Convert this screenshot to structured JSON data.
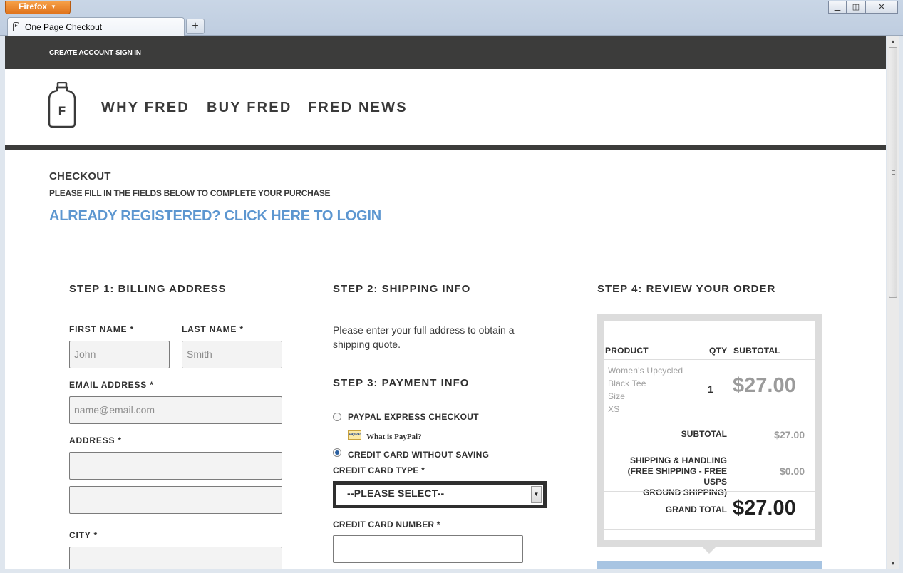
{
  "browser": {
    "menu_label": "Firefox",
    "tab_title": "One Page Checkout",
    "new_tab": "+",
    "controls": {
      "minimize": "▁",
      "restore": "◫",
      "close": "✕"
    }
  },
  "topbar": {
    "create_account": "CREATE ACCOUNT",
    "sign_in": "SIGN IN"
  },
  "logo": {
    "letter": "F"
  },
  "nav": [
    "WHY FRED",
    "BUY FRED",
    "FRED NEWS"
  ],
  "checkout": {
    "title": "CHECKOUT",
    "subtitle": "PLEASE FILL IN THE FIELDS BELOW TO COMPLETE YOUR PURCHASE",
    "login_link": "ALREADY REGISTERED? CLICK HERE TO LOGIN"
  },
  "billing": {
    "heading": "STEP 1: BILLING ADDRESS",
    "first_name_label": "FIRST NAME *",
    "first_name_placeholder": "John",
    "last_name_label": "LAST NAME *",
    "last_name_placeholder": "Smith",
    "email_label": "EMAIL ADDRESS *",
    "email_placeholder": "name@email.com",
    "address_label": "ADDRESS *",
    "city_label": "CITY *"
  },
  "shipping": {
    "heading": "STEP 2: SHIPPING INFO",
    "text": "Please enter your full address to obtain a shipping quote."
  },
  "payment": {
    "heading": "STEP 3: PAYMENT INFO",
    "options": [
      {
        "label": "PAYPAL EXPRESS CHECKOUT",
        "selected": false
      },
      {
        "label": "CREDIT CARD WITHOUT SAVING",
        "selected": true
      }
    ],
    "paypal_badge": "PayPal",
    "paypal_link": "What is PayPal?",
    "card_type_label": "CREDIT CARD TYPE *",
    "card_type_value": "--PLEASE SELECT--",
    "card_number_label": "CREDIT CARD NUMBER *"
  },
  "review": {
    "heading": "STEP 4: REVIEW YOUR ORDER",
    "columns": {
      "product": "PRODUCT",
      "qty": "QTY",
      "subtotal": "SUBTOTAL"
    },
    "item": {
      "name_line1": "Women's Upcycled",
      "name_line2": "Black Tee",
      "size_label": "Size",
      "size_value": "XS",
      "qty": "1",
      "price": "$27.00"
    },
    "subtotal_label": "SUBTOTAL",
    "subtotal_value": "$27.00",
    "shipping_label_1": "SHIPPING & HANDLING",
    "shipping_label_2": "(FREE SHIPPING - FREE USPS",
    "shipping_label_3": "GROUND SHIPPING)",
    "shipping_value": "$0.00",
    "grand_total_label": "GRAND TOTAL",
    "grand_total_value": "$27.00"
  }
}
